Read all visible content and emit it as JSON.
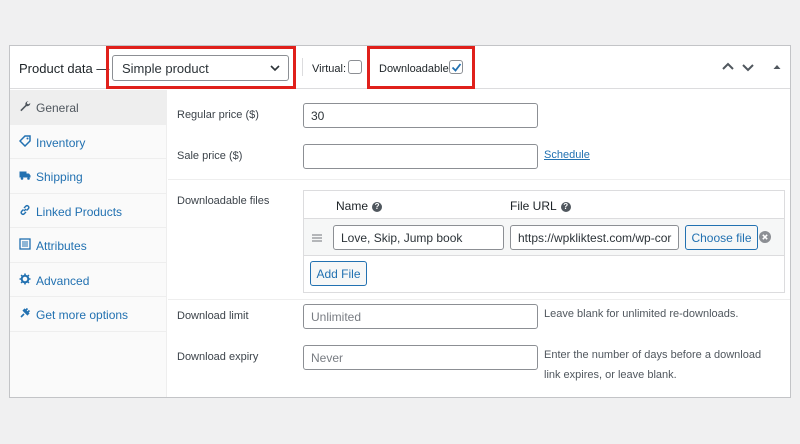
{
  "header": {
    "title": "Product data —",
    "product_type": "Simple product",
    "virtual_label": "Virtual:",
    "virtual_checked": false,
    "downloadable_label": "Downloadable:",
    "downloadable_checked": true,
    "highlight_color": "#e0201b"
  },
  "tabs": [
    {
      "label": "General",
      "icon": "wrench-icon",
      "active": true
    },
    {
      "label": "Inventory",
      "icon": "tag-icon",
      "active": false
    },
    {
      "label": "Shipping",
      "icon": "truck-icon",
      "active": false
    },
    {
      "label": "Linked Products",
      "icon": "link-icon",
      "active": false
    },
    {
      "label": "Attributes",
      "icon": "list-icon",
      "active": false
    },
    {
      "label": "Advanced",
      "icon": "gear-icon",
      "active": false
    },
    {
      "label": "Get more options",
      "icon": "plugin-icon",
      "active": false
    }
  ],
  "general": {
    "regular_price_label": "Regular price ($)",
    "regular_price_value": "30",
    "sale_price_label": "Sale price ($)",
    "sale_price_value": "",
    "schedule_link": "Schedule",
    "downloadable_files_label": "Downloadable files",
    "files_table": {
      "name_header": "Name",
      "url_header": "File URL",
      "rows": [
        {
          "name": "Love, Skip, Jump book",
          "url": "https://wpkliktest.com/wp-cor",
          "choose_label": "Choose file"
        }
      ],
      "add_file_label": "Add File"
    },
    "download_limit_label": "Download limit",
    "download_limit_placeholder": "Unlimited",
    "download_limit_hint": "Leave blank for unlimited re-downloads.",
    "download_expiry_label": "Download expiry",
    "download_expiry_placeholder": "Never",
    "download_expiry_hint": "Enter the number of days before a download link expires, or leave blank."
  },
  "colors": {
    "link": "#2271b1",
    "border": "#8c8f94",
    "accent_highlight": "#e0201b"
  }
}
